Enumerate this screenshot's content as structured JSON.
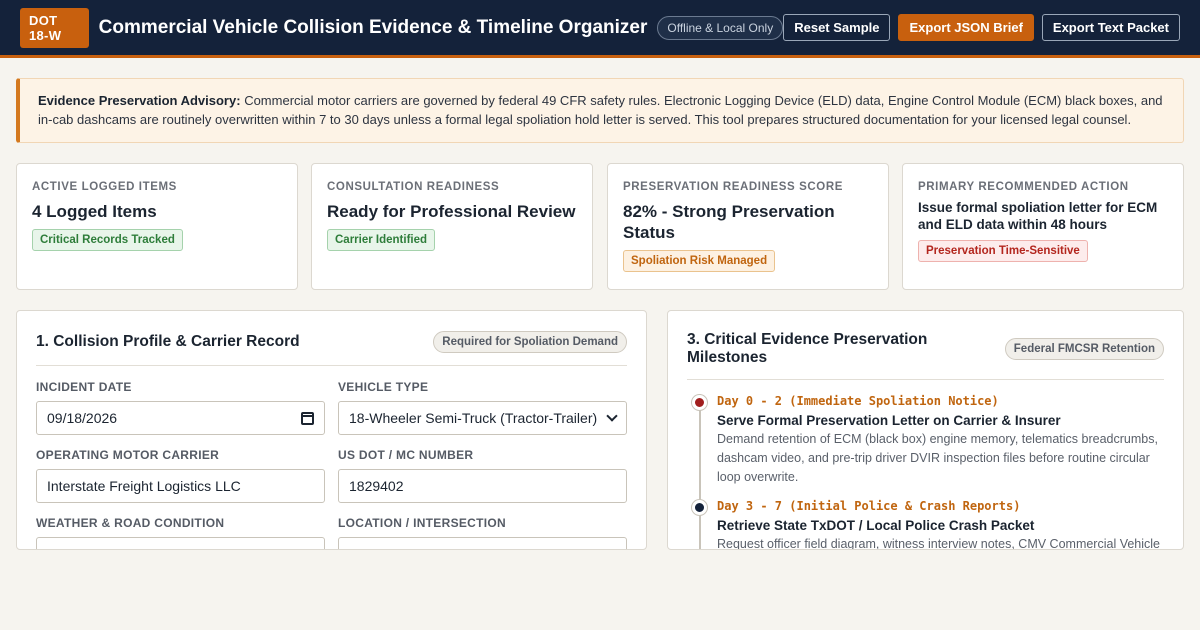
{
  "header": {
    "badge": "DOT 18-W",
    "title": "Commercial Vehicle Collision Evidence & Timeline Organizer",
    "mode_pill": "Offline & Local Only",
    "reset_label": "Reset Sample",
    "export_json_label": "Export JSON Brief",
    "export_text_label": "Export Text Packet"
  },
  "advisory": {
    "lead": "Evidence Preservation Advisory:",
    "body": "Commercial motor carriers are governed by federal 49 CFR safety rules. Electronic Logging Device (ELD) data, Engine Control Module (ECM) black boxes, and in-cab dashcams are routinely overwritten within 7 to 30 days unless a formal legal spoliation hold letter is served. This tool prepares structured documentation for your licensed legal counsel."
  },
  "stats": [
    {
      "label": "Active Logged Items",
      "value": "4 Logged Items",
      "pill": "Critical Records Tracked",
      "pill_color": "#2e7d3a"
    },
    {
      "label": "Consultation Readiness",
      "value": "Ready for Professional Review",
      "pill": "Carrier Identified",
      "pill_color": "#2e7d3a"
    },
    {
      "label": "Preservation Readiness Score",
      "value": "82% - Strong Preservation Status",
      "pill": "Spoliation Risk Managed",
      "pill_color": "#c0650f"
    },
    {
      "label": "Primary Recommended Action",
      "value": "Issue formal spoliation letter for ECM and ELD data within 48 hours",
      "pill": "Preservation Time-Sensitive",
      "pill_color": "#b3261e"
    }
  ],
  "profile": {
    "title": "1. Collision Profile & Carrier Record",
    "tag": "Required for Spoliation Demand",
    "fields": {
      "incident_date": {
        "label": "Incident Date",
        "value": "09/18/2026"
      },
      "vehicle_type": {
        "label": "Vehicle Type",
        "value": "18-Wheeler Semi-Truck (Tractor-Trailer)"
      },
      "carrier": {
        "label": "Operating Motor Carrier",
        "value": "Interstate Freight Logistics LLC"
      },
      "dot_number": {
        "label": "US DOT / MC Number",
        "value": "1829402"
      },
      "weather": {
        "label": "Weather & Road Condition"
      },
      "location": {
        "label": "Location / Intersection"
      }
    }
  },
  "milestones": {
    "title": "3. Critical Evidence Preservation Milestones",
    "tag": "Federal FMCSR Retention",
    "items": [
      {
        "day": "Day 0 - 2 (Immediate Spoliation Notice)",
        "heading": "Serve Formal Preservation Letter on Carrier & Insurer",
        "desc": "Demand retention of ECM (black box) engine memory, telematics breadcrumbs, dashcam video, and pre-trip driver DVIR inspection files before routine circular loop overwrite.",
        "dot_color": "#a11e1e"
      },
      {
        "day": "Day 3 - 7 (Initial Police & Crash Reports)",
        "heading": "Retrieve State TxDOT / Local Police Crash Packet",
        "desc": "Request officer field diagram, witness interview notes, CMV Commercial Vehicle",
        "dot_color": "#14223a"
      }
    ]
  }
}
